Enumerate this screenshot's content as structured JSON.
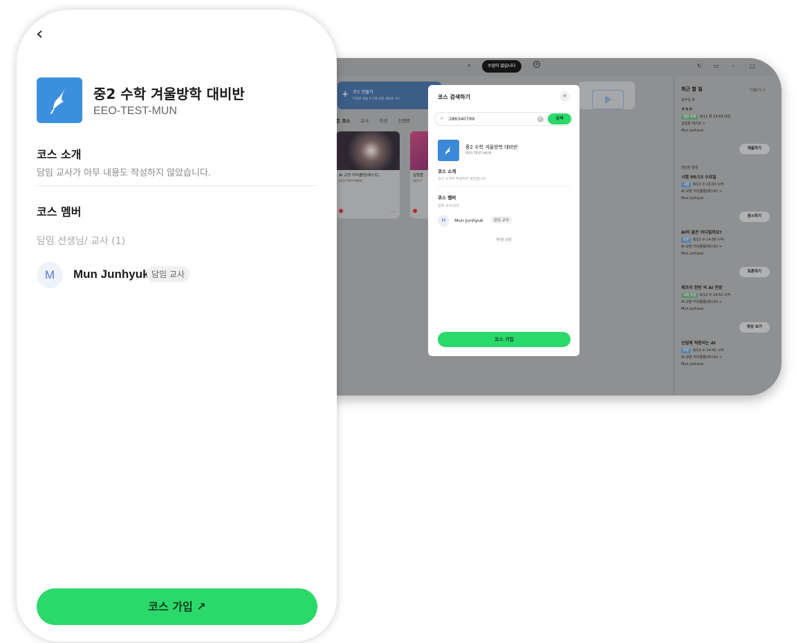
{
  "desktop": {
    "search_pill": "수업이 없습니다",
    "create_course": {
      "title": "코스 만들기",
      "subtitle": "다양한 학습 도구를 갖춘 새로운 코스"
    },
    "tabs": [
      "든 코스",
      "교사",
      "학생",
      "진행중"
    ],
    "courses": [
      {
        "title": "AI 교양 커리큘럼(테스트)",
        "code": "EEO-TEST-MUN"
      },
      {
        "title": "실험용",
        "code": "EEO-T"
      }
    ],
    "right_panel": {
      "title": "최근 할 일",
      "more": "더보기 ↗",
      "section1": "일주일 후",
      "section2": "마감된 항목",
      "tasks": [
        {
          "title": "ㅎㅎㅎ",
          "tag": "결말 과제",
          "time": "8/11 목 23:59 마감",
          "course": "실험용 테스트 >",
          "teacher": "Mun Junhyuk",
          "button": "제출하기"
        },
        {
          "title": "시험 08/13 수요일",
          "tag": "시험",
          "time": "8/13 수 15:03 시작",
          "course": "AI 교양 커리큘럼(테스트) >",
          "teacher": "Mun Junhyuk",
          "button": "응시하기"
        },
        {
          "title": "AI의 끝은 어디일까요?",
          "tag": "토론",
          "time": "8/13 수 14:56 시작",
          "course": "AI 교양 커리큘럼(테스트) >",
          "teacher": "Mun Junhyuk",
          "button": "토론하기"
        },
        {
          "title": "제프리 힌턴 의 AI 전망",
          "tag": "녹화 수업",
          "time": "8/13 수 14:52 시작",
          "course": "AI 교양 커리큘럼(테스트) >",
          "teacher": "Mun Junhyuk",
          "button": "영상 보기"
        },
        {
          "title": "산업에 적용되는 AI",
          "tag": "토론",
          "time": "8/13 수 14:41 시작",
          "course": "AI 교양 커리큘럼(테스트) >",
          "teacher": "Mun Junhyuk",
          "button": ""
        }
      ]
    }
  },
  "modal": {
    "title": "코스 검색하기",
    "search_value": "286340799",
    "search_button": "검색",
    "course_name": "중2 수학 겨울방학 대비반",
    "course_code": "EEO-TEST-MUN",
    "intro_label": "코스 소개",
    "intro_text": "코스 소개가 작성되지 않았습니다",
    "members_label": "코스 멤버",
    "role_label": "담임 교사/교사",
    "avatar_letter": "M",
    "member_name": "Mun Junhyuk",
    "member_badge": "담임 교사",
    "students": "학생 0명",
    "join_button": "코스 가입"
  },
  "phone": {
    "back": "‹",
    "course_name": "중2 수학 겨울방학 대비반",
    "course_code": "EEO-TEST-MUN",
    "intro_label": "코스 소개",
    "intro_text": "담임 교사가 아무 내용도 작성하지 않았습니다.",
    "members_label": "코스 멤버",
    "role_label": "담임 선생님/ 교사 (1)",
    "avatar_letter": "M",
    "member_name": "Mun Junhyuk",
    "member_badge": "담임 교사",
    "join_button": "코스 가입 ↗"
  },
  "colors": {
    "accent_green": "#2bd96a",
    "course_icon_blue": "#3c8fdc"
  }
}
